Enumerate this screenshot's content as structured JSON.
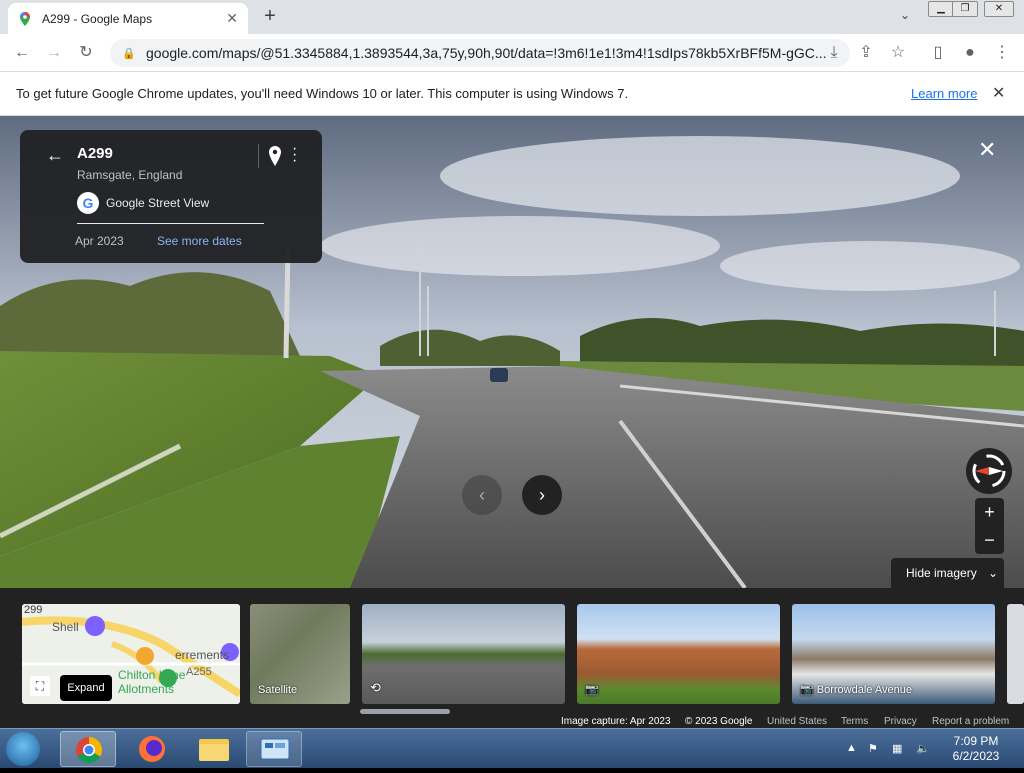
{
  "browser": {
    "tab_title": "A299 - Google Maps",
    "tab_close": "✕",
    "new_tab": "+",
    "tab_search": "⌄",
    "url": "google.com/maps/@51.3345884,1.3893544,3a,75y,90h,90t/data=!3m6!1e1!3m4!1sdIps78kb5XrBFf5M-gGC..."
  },
  "infobar": {
    "message": "To get future Google Chrome updates, you'll need Windows 10 or later. This computer is using Windows 7.",
    "link": "Learn more",
    "close": "✕"
  },
  "streetview": {
    "place": "A299",
    "location": "Ramsgate, England",
    "source": "Google Street View",
    "capture_date": "Apr 2023",
    "more_dates": "See more dates",
    "close": "✕",
    "prev": "‹",
    "next": "›",
    "zoom_in": "+",
    "zoom_out": "−",
    "hide_imagery": "Hide imagery",
    "hide_chev": "⌄"
  },
  "map_thumb": {
    "shell": "Shell",
    "road": "299",
    "place1": "errements",
    "place2": "Chilton Lane",
    "place3": "Allotments",
    "road2": "A255"
  },
  "thumbs": {
    "satellite": "Satellite",
    "photo3": "Borrowdale Avenue"
  },
  "expand": {
    "tooltip": "Expand"
  },
  "footer": {
    "capture": "Image capture: Apr 2023",
    "copyright": "© 2023 Google",
    "country": "United States",
    "terms": "Terms",
    "privacy": "Privacy",
    "report": "Report a problem"
  },
  "taskbar": {
    "time": "7:09 PM",
    "date": "6/2/2023"
  },
  "colors": {
    "link_blue": "#8ab4f8",
    "panel": "#202124",
    "accent_red": "#d93025"
  }
}
